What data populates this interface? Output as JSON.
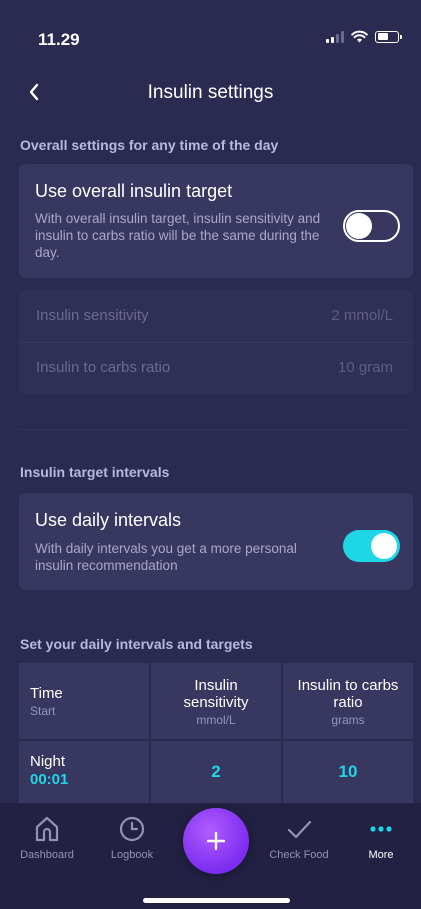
{
  "status_bar": {
    "time": "11.29"
  },
  "nav": {
    "title": "Insulin settings"
  },
  "overall": {
    "section_title": "Overall settings for any time of the day",
    "toggle_title": "Use overall insulin target",
    "toggle_desc": "With overall insulin target, insulin sensitivity and insulin to carbs ratio will be the same during the day.",
    "toggle_on": false,
    "rows": [
      {
        "label": "Insulin sensitivity",
        "value": "2 mmol/L"
      },
      {
        "label": "Insulin to carbs ratio",
        "value": "10 gram"
      }
    ]
  },
  "intervals": {
    "section_title": "Insulin target intervals",
    "toggle_title": "Use daily intervals",
    "toggle_desc": "With daily intervals you get a more personal insulin recommendation",
    "toggle_on": true
  },
  "table": {
    "section_title": "Set your daily intervals and targets",
    "headers": [
      {
        "main": "Time",
        "sub": "Start"
      },
      {
        "main": "Insulin sensitivity",
        "sub": "mmol/L"
      },
      {
        "main": "Insulin to carbs ratio",
        "sub": "grams"
      }
    ],
    "rows": [
      {
        "name": "Night",
        "start": "00:01",
        "sensitivity": "2",
        "ratio": "10"
      }
    ]
  },
  "tab_bar": {
    "items": [
      {
        "label": "Dashboard",
        "icon": "home-icon"
      },
      {
        "label": "Logbook",
        "icon": "clock-icon"
      },
      {
        "label": "Check Food",
        "icon": "checkmark-icon"
      },
      {
        "label": "More",
        "icon": "more-dots-icon",
        "active": true
      }
    ],
    "add_icon": "plus-icon"
  },
  "colors": {
    "background": "#2b2a50",
    "card": "#38375f",
    "accent": "#1fd6e6",
    "add_button": "#9b45f7"
  }
}
